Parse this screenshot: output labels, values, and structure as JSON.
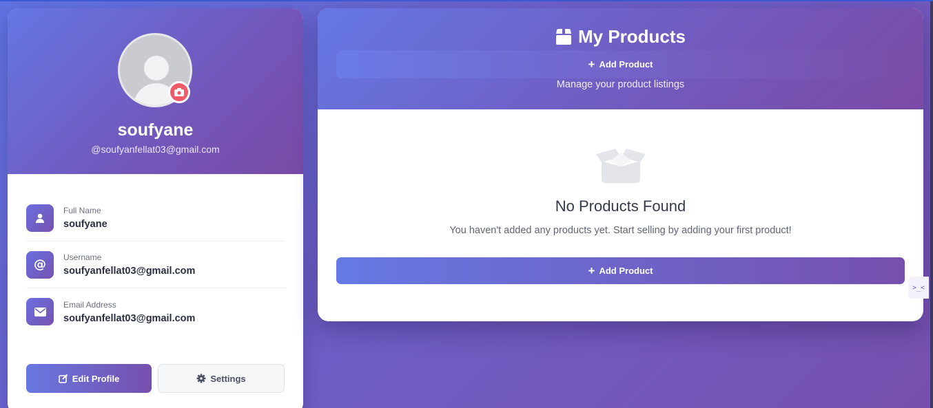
{
  "profile": {
    "name": "soufyane",
    "handle": "@soufyanfellat03@gmail.com",
    "fields": [
      {
        "label": "Full Name",
        "value": "soufyane",
        "icon": "user-icon"
      },
      {
        "label": "Username",
        "value": "soufyanfellat03@gmail.com",
        "icon": "at-icon"
      },
      {
        "label": "Email Address",
        "value": "soufyanfellat03@gmail.com",
        "icon": "envelope-icon"
      }
    ],
    "edit_label": "Edit Profile",
    "settings_label": "Settings"
  },
  "products": {
    "title": "My Products",
    "header_add_label": "Add Product",
    "subtitle": "Manage your product listings",
    "empty_title": "No Products Found",
    "empty_text": "You haven't added any products yet. Start selling by adding your first product!",
    "add_label": "Add Product"
  },
  "side_widget": {
    "label": ">_<"
  },
  "colors": {
    "accent_start": "#6679e3",
    "accent_end": "#7650ae",
    "camera": "#ef5b67"
  }
}
